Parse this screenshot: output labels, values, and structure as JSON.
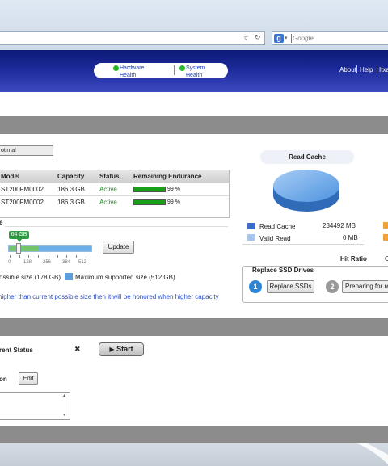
{
  "browser": {
    "search_placeholder": "Google"
  },
  "header": {
    "nav": [
      {
        "label": "Hardware Health",
        "line1": "Hardware",
        "line2": "Health"
      },
      {
        "label": "System Health",
        "line1": "System",
        "line2": "Health"
      }
    ],
    "links": {
      "about": "About",
      "help": "Help",
      "user": "Itxa"
    }
  },
  "cache_status": "otimal",
  "ssd_table": {
    "headers": {
      "model": "Model",
      "capacity": "Capacity",
      "status": "Status",
      "endurance": "Remaining Endurance"
    },
    "rows": [
      {
        "model": "ST200FM0002",
        "capacity": "186.3 GB",
        "status": "Active",
        "endurance": "99 %",
        "endurance_fraction": 0.99
      },
      {
        "model": "ST200FM0002",
        "capacity": "186.3 GB",
        "status": "Active",
        "endurance": "99 %",
        "endurance_fraction": 0.99
      }
    ]
  },
  "size_section": {
    "heading_fragment": "e",
    "slider": {
      "value_label": "64 GB",
      "value": 64,
      "max": 512,
      "ticks": [
        "0",
        "128",
        "256",
        "384",
        "512"
      ],
      "possible_fraction": 0.35
    },
    "update_button": "Update",
    "possible_label": "ossible size (178 GB)",
    "max_label": "Maximum supported size (512 GB)",
    "note": "higher than current possible size then it will be honored when higher capacity"
  },
  "read_cache": {
    "title": "Read Cache",
    "stats": [
      {
        "label": "Read Cache",
        "value": "234492 MB",
        "color": "#3b6fc2"
      },
      {
        "label": "Valid Read",
        "value": "0 MB",
        "color": "#a8c6ea"
      }
    ],
    "side_color": "#f0a23a",
    "hit_ratio_label": "Hit Ratio",
    "hit_ratio_fragment": "C"
  },
  "replace": {
    "title": "Replace SSD Drives",
    "step1": {
      "num": "1",
      "button": "Replace SSDs"
    },
    "step2": {
      "num": "2",
      "button": "Preparing for re"
    }
  },
  "bottom": {
    "status_label": "rent Status",
    "close_glyph": "✖",
    "start_button": "Start",
    "edit_label": "on",
    "edit_button": "Edit"
  }
}
